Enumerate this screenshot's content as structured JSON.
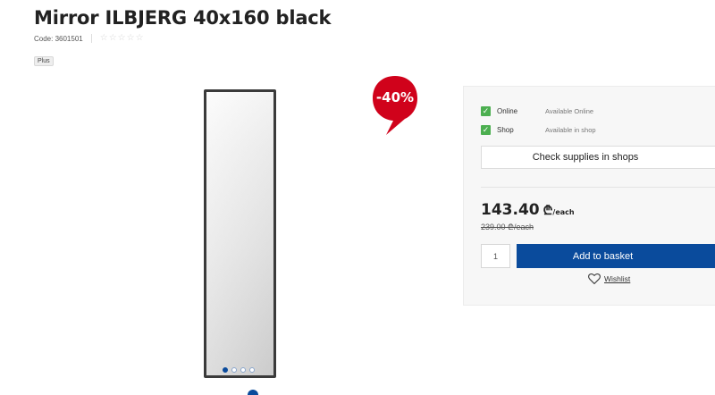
{
  "product": {
    "title": "Mirror ILBJERG 40x160 black",
    "code_label": "Code: 3601501",
    "rating_stars": [
      "☆",
      "☆",
      "☆",
      "☆",
      "☆"
    ],
    "tag": "Plus"
  },
  "gallery": {
    "dot_count": 4,
    "active_dot_index": 0
  },
  "discount_badge": {
    "text": "-40%",
    "color": "#d0021b"
  },
  "availability": {
    "items": [
      {
        "label": "Online",
        "status": "Available Online",
        "checked": true
      },
      {
        "label": "Shop",
        "status": "Available in shop",
        "checked": true
      }
    ],
    "check_button": "Check supplies in shops"
  },
  "pricing": {
    "price": "143.40",
    "currency": "₾",
    "unit": "/each",
    "old_price": "239.00 ₾/each"
  },
  "purchase": {
    "quantity": "1",
    "add_button": "Add to basket",
    "wishlist": "Wishlist"
  },
  "colors": {
    "accent_blue": "#0a4b9c",
    "check_green": "#4caf50",
    "badge_red": "#d0021b"
  },
  "icons": {
    "check": "check-icon",
    "heart": "heart-outline-icon",
    "star": "star-outline-icon"
  }
}
